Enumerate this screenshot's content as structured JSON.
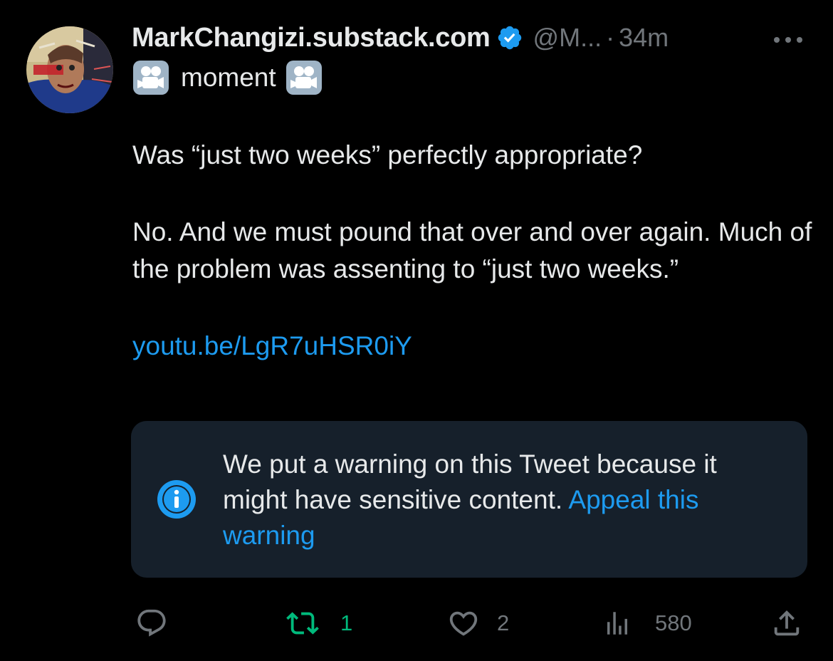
{
  "author": {
    "display_name": "MarkChangizi.substack.com",
    "handle": "@M...",
    "separator": "·",
    "time": "34m",
    "verified_icon": "verified-badge-icon",
    "avatar_alt": "avatar"
  },
  "subline": {
    "prefix_icon": "movie-camera-icon",
    "word": "moment",
    "suffix_icon": "movie-camera-icon"
  },
  "tweet": {
    "line1": "Was “just two weeks” perfectly appropriate?",
    "para2": "No. And we must pound that over and over again. Much of the problem was assenting to “just two weeks.”",
    "link": "youtu.be/LgR7uHSR0iY"
  },
  "warning": {
    "text": "We put a warning on this Tweet because it might have sensitive content.",
    "appeal_link": "Appeal this warning",
    "icon": "info-icon"
  },
  "actions": {
    "reply": {
      "icon": "reply-icon",
      "count": ""
    },
    "retweet": {
      "icon": "retweet-icon",
      "count": "1"
    },
    "like": {
      "icon": "heart-icon",
      "count": "2"
    },
    "views": {
      "icon": "views-icon",
      "count": "580"
    },
    "share": {
      "icon": "share-icon",
      "count": ""
    }
  },
  "colors": {
    "background": "#000000",
    "text_primary": "#e7e9ea",
    "text_secondary": "#71767b",
    "accent_blue": "#1d9bf0",
    "retweet_green": "#00ba7c",
    "warning_bg": "#16202b"
  }
}
